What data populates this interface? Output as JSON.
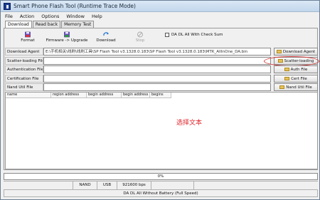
{
  "window": {
    "title": "Smart Phone Flash Tool (Runtime Trace Mode)"
  },
  "menu": [
    "File",
    "Action",
    "Options",
    "Window",
    "Help"
  ],
  "tabs": [
    "Download",
    "Read back",
    "Memory Test"
  ],
  "toolbar": {
    "format": "Format",
    "firmware_upgrade": "Firmware -> Upgrade",
    "download": "Download",
    "stop": "Stop"
  },
  "checksum_label": "DA DL All With Check Sum",
  "rows": {
    "download_agent": {
      "label": "Download Agent",
      "value": "E:\\手机相关\\线刷\\线刷工具\\SP Flash Tool v3.1328.0.183\\SP Flash Tool v3.1328.0.183\\MTK_AllInOne_DA.bin",
      "button": "Download Agent"
    },
    "scatter": {
      "label": "Scatter-loading File",
      "value": "",
      "button": "Scatter-loading"
    },
    "authentication": {
      "label": "Authentication File",
      "value": "",
      "button": "Auth File"
    },
    "certification": {
      "label": "Certification File",
      "value": "",
      "button": "Cert File"
    },
    "nand_util": {
      "label": "Nand Util File",
      "value": "",
      "button": "Nand Util File"
    }
  },
  "table": {
    "columns": [
      "name",
      "region address",
      "begin address",
      "begin address",
      "begins"
    ]
  },
  "annotation": "选择文本",
  "progress": {
    "percent": 0,
    "text": "0%"
  },
  "status": [
    "",
    "NAND",
    "USB",
    "921600 bps",
    "",
    ""
  ],
  "mode": "DA DL All Without Battery (Full Speed)",
  "colors": {
    "accent": "#3a6fd8",
    "annotation": "#e0242a",
    "highlight": "#d23b3b"
  }
}
